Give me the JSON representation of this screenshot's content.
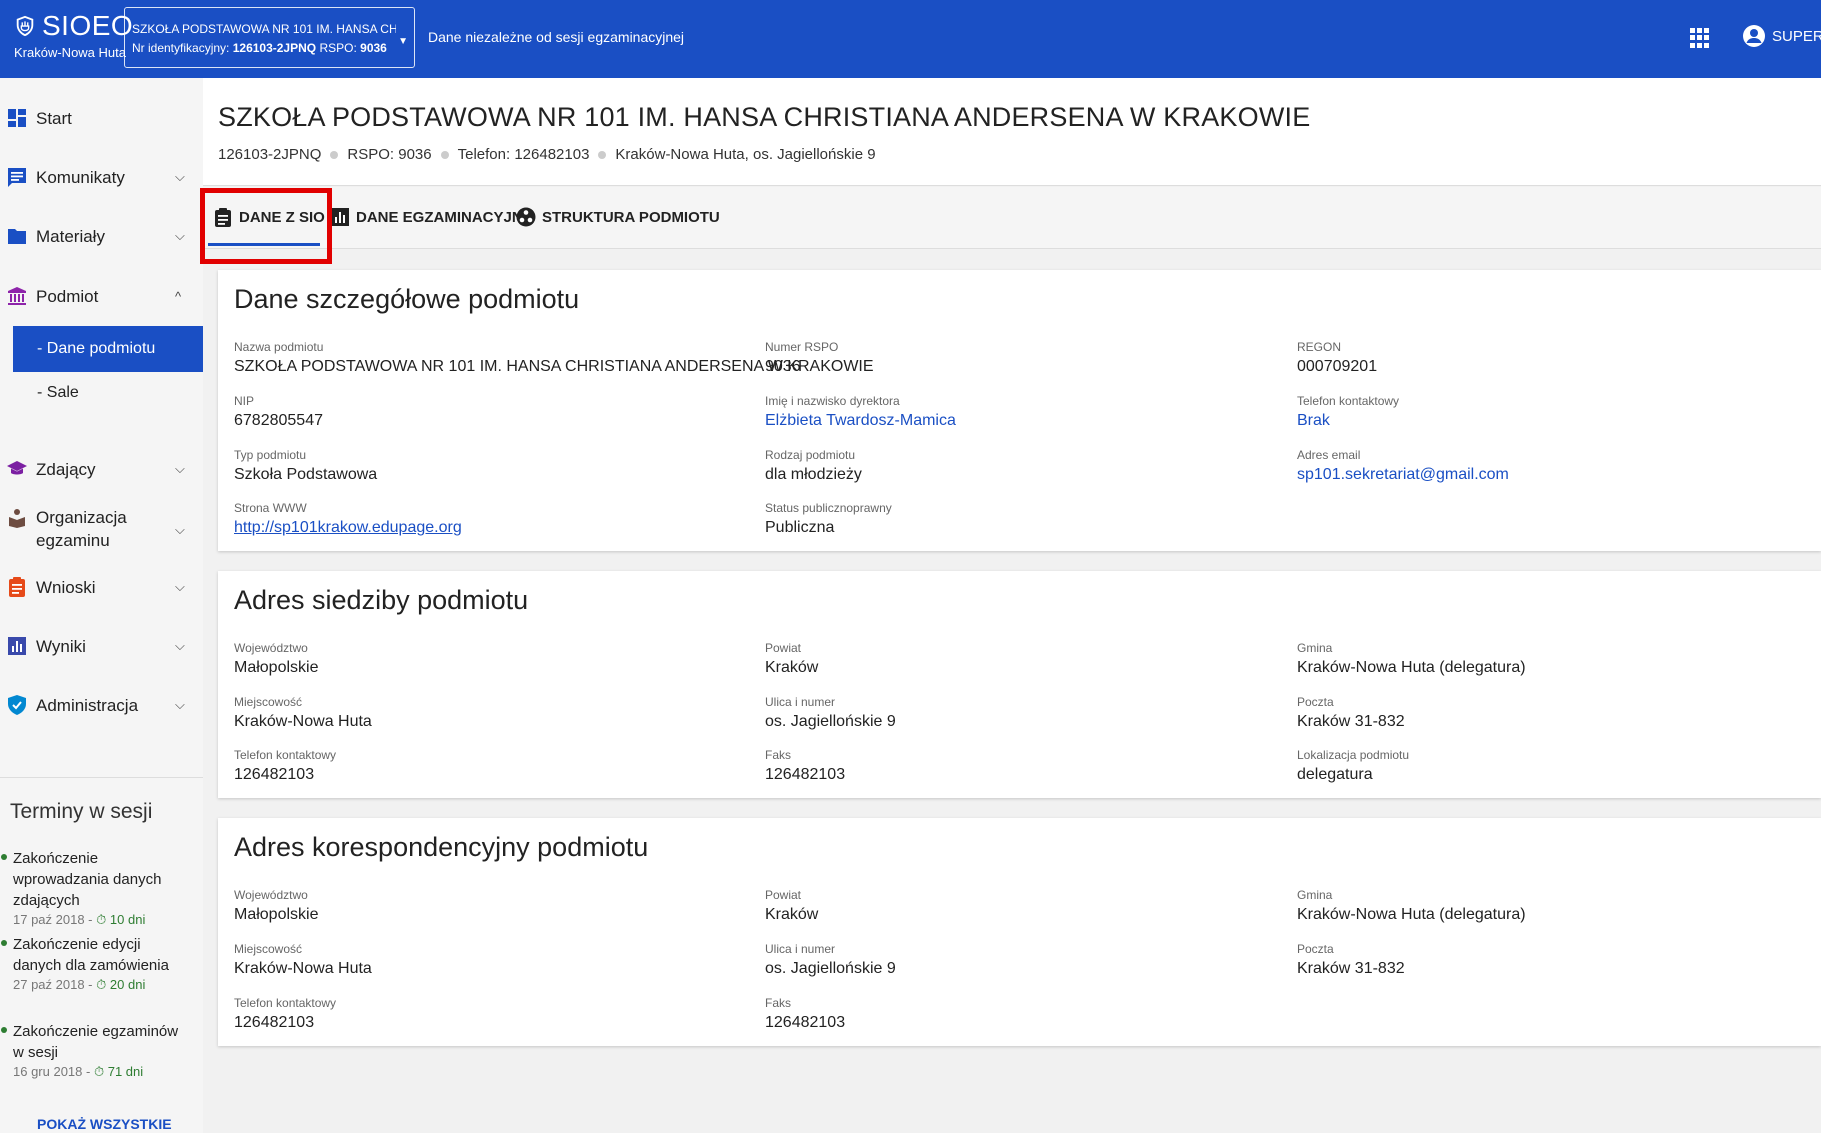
{
  "topbar": {
    "logo": "SIOEO",
    "logo_sub": "Kraków-Nowa Huta",
    "school_line1": "SZKOŁA PODSTAWOWA NR 101 IM. HANSA CHRIST...",
    "school_id_label": "Nr identyfikacyjny:",
    "school_id": "126103-2JPNQ",
    "school_rspo_label": "RSPO:",
    "school_rspo": "9036",
    "note": "Dane niezależne od sesji egzaminacyjnej",
    "user": "SUPER"
  },
  "sidebar": {
    "items": [
      {
        "label": "Start"
      },
      {
        "label": "Komunikaty"
      },
      {
        "label": "Materiały"
      },
      {
        "label": "Podmiot"
      },
      {
        "label": "Zdający"
      },
      {
        "label": "Organizacja egzaminu"
      },
      {
        "label": "Wnioski"
      },
      {
        "label": "Wyniki"
      },
      {
        "label": "Administracja"
      }
    ],
    "sub_active": "- Dane podmiotu",
    "sub_item": "- Sale",
    "terms_title": "Terminy w sesji",
    "terms": [
      {
        "title": "Zakończenie wprowadzania danych zdających",
        "date": "17 paź 2018 -",
        "left": "10 dni"
      },
      {
        "title": "Zakończenie edycji danych dla zamówienia",
        "date": "27 paź 2018 -",
        "left": "20 dni"
      },
      {
        "title": "Zakończenie egzaminów w sesji",
        "date": "16 gru 2018 -",
        "left": "71 dni"
      }
    ],
    "show_all": "POKAŻ WSZYSTKIE"
  },
  "header": {
    "title": "SZKOŁA PODSTAWOWA NR 101 IM. HANSA CHRISTIANA ANDERSENA W KRAKOWIE",
    "id": "126103-2JPNQ",
    "rspo": "RSPO: 9036",
    "phone": "Telefon: 126482103",
    "address": "Kraków-Nowa Huta, os. Jagiellońskie 9"
  },
  "tabs": [
    {
      "label": "DANE Z SIO"
    },
    {
      "label": "DANE EGZAMINACYJNE"
    },
    {
      "label": "STRUKTURA PODMIOTU"
    }
  ],
  "cards": {
    "details": {
      "title": "Dane szczegółowe podmiotu",
      "nazwa_label": "Nazwa podmiotu",
      "nazwa": "SZKOŁA PODSTAWOWA NR 101 IM. HANSA CHRISTIANA ANDERSENA W KRAKOWIE",
      "rspo_label": "Numer RSPO",
      "rspo": "9036",
      "regon_label": "REGON",
      "regon": "000709201",
      "nip_label": "NIP",
      "nip": "6782805547",
      "dyrektor_label": "Imię i nazwisko dyrektora",
      "dyrektor": "Elżbieta Twardosz-Mamica",
      "telefon_label": "Telefon kontaktowy",
      "telefon": "Brak",
      "typ_label": "Typ podmiotu",
      "typ": "Szkoła Podstawowa",
      "rodzaj_label": "Rodzaj podmiotu",
      "rodzaj": "dla młodzieży",
      "email_label": "Adres email",
      "email": "sp101.sekretariat@gmail.com",
      "www_label": "Strona WWW",
      "www": "http://sp101krakow.edupage.org",
      "status_label": "Status publicznoprawny",
      "status": "Publiczna"
    },
    "siedziba": {
      "title": "Adres siedziby podmiotu",
      "woj_label": "Województwo",
      "woj": "Małopolskie",
      "powiat_label": "Powiat",
      "powiat": "Kraków",
      "gmina_label": "Gmina",
      "gmina": "Kraków-Nowa Huta (delegatura)",
      "miejsc_label": "Miejscowość",
      "miejsc": "Kraków-Nowa Huta",
      "ulica_label": "Ulica i numer",
      "ulica": "os. Jagiellońskie 9",
      "poczta_label": "Poczta",
      "poczta": "Kraków 31-832",
      "tel_label": "Telefon kontaktowy",
      "tel": "126482103",
      "faks_label": "Faks",
      "faks": "126482103",
      "lok_label": "Lokalizacja podmiotu",
      "lok": "delegatura"
    },
    "koresp": {
      "title": "Adres korespondencyjny podmiotu",
      "woj_label": "Województwo",
      "woj": "Małopolskie",
      "powiat_label": "Powiat",
      "powiat": "Kraków",
      "gmina_label": "Gmina",
      "gmina": "Kraków-Nowa Huta (delegatura)",
      "miejsc_label": "Miejscowość",
      "miejsc": "Kraków-Nowa Huta",
      "ulica_label": "Ulica i numer",
      "ulica": "os. Jagiellońskie 9",
      "poczta_label": "Poczta",
      "poczta": "Kraków 31-832",
      "tel_label": "Telefon kontaktowy",
      "tel": "126482103",
      "faks_label": "Faks",
      "faks": "126482103"
    }
  },
  "colors": {
    "primary": "#1a4fc4",
    "highlight": "#e10000",
    "success": "#2e7d32"
  }
}
